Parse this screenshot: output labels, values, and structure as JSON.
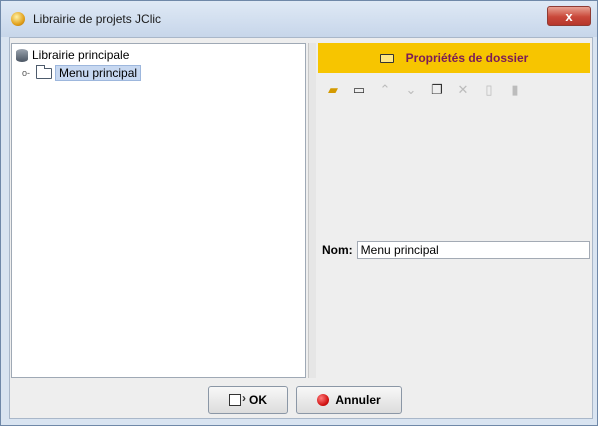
{
  "window": {
    "title": "Librairie de projets JClic",
    "close_label": "x"
  },
  "tree": {
    "root_label": "Librairie principale",
    "child_label": "Menu principal",
    "expander_glyph": "o-"
  },
  "properties": {
    "header_title": "Propriétés de dossier",
    "accent_color": "#f7c500",
    "toolbar": [
      {
        "icon": "new-project-icon",
        "enabled": true
      },
      {
        "icon": "new-folder-icon",
        "enabled": true
      },
      {
        "icon": "move-up-icon",
        "enabled": false
      },
      {
        "icon": "move-down-icon",
        "enabled": false
      },
      {
        "icon": "copy-icon",
        "enabled": true
      },
      {
        "icon": "cut-icon",
        "enabled": false
      },
      {
        "icon": "paste-icon",
        "enabled": false
      },
      {
        "icon": "delete-icon",
        "enabled": false
      }
    ],
    "name_label": "Nom:",
    "name_value": "Menu principal"
  },
  "buttons": {
    "ok_label": "OK",
    "cancel_label": "Annuler"
  }
}
